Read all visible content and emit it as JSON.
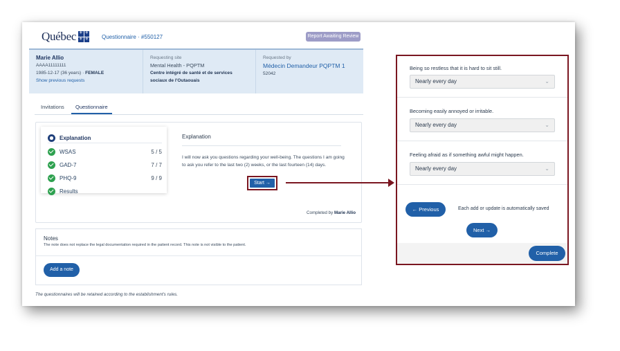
{
  "header": {
    "logo_text": "Québec",
    "questionnaire_label": "Questionnaire · #550127",
    "report_badge": "Report Awaiting Review"
  },
  "patient": {
    "name": "Marie Allio",
    "id": "AAAA11111111",
    "dob_age": "1985-12-17 (36 years) · ",
    "sex": "FEMALE",
    "previous_link": "Show previous requests"
  },
  "requesting_site": {
    "label": "Requesting site",
    "program": "Mental Health - PQPTM",
    "institution": "Centre intégré de santé et de services sociaux de l'Outaouais"
  },
  "requested_by": {
    "label": "Requested by",
    "name": "Médecin Demandeur PQPTM 1",
    "code": "52042"
  },
  "tabs": [
    "Invitations",
    "Questionnaire"
  ],
  "steps": [
    {
      "label": "Explanation",
      "count": "",
      "status": "current"
    },
    {
      "label": "WSAS",
      "count": "5 / 5",
      "status": "done"
    },
    {
      "label": "GAD-7",
      "count": "7 / 7",
      "status": "done"
    },
    {
      "label": "PHQ-9",
      "count": "9 / 9",
      "status": "done"
    },
    {
      "label": "Results",
      "count": "",
      "status": "done"
    }
  ],
  "explanation": {
    "title": "Explanation",
    "text": "I will now ask you questions regarding your well-being. The questions I am going to ask you refer to the last two (2) weeks, or the last fourteen (14) days.",
    "start_button": "Start →",
    "completed_prefix": "Completed by ",
    "completed_by": "Marie Allio"
  },
  "notes": {
    "title": "Notes",
    "subtitle": "The note does not replace the legal documentation required in the patient record. This note is not visible to the patient.",
    "add_button": "Add a note"
  },
  "retention_note": "The questionnaires will be retained according to the establishment's rules.",
  "zoom_panel": {
    "questions": [
      {
        "text": "Being so restless that it is hard to sit still.",
        "answer": "Nearly every day"
      },
      {
        "text": "Becoming easily annoyed or irritable.",
        "answer": "Nearly every day"
      },
      {
        "text": "Feeling afraid as if something awful might happen.",
        "answer": "Nearly every day"
      }
    ],
    "previous_button": "← Previous",
    "autosave_text": "Each add or update is automatically saved",
    "next_button": "Next →",
    "complete_button": "Complete"
  },
  "colors": {
    "primary": "#2160a8",
    "highlight_border": "#7a1620",
    "success": "#2ea14f",
    "band": "#dfeaf5"
  }
}
